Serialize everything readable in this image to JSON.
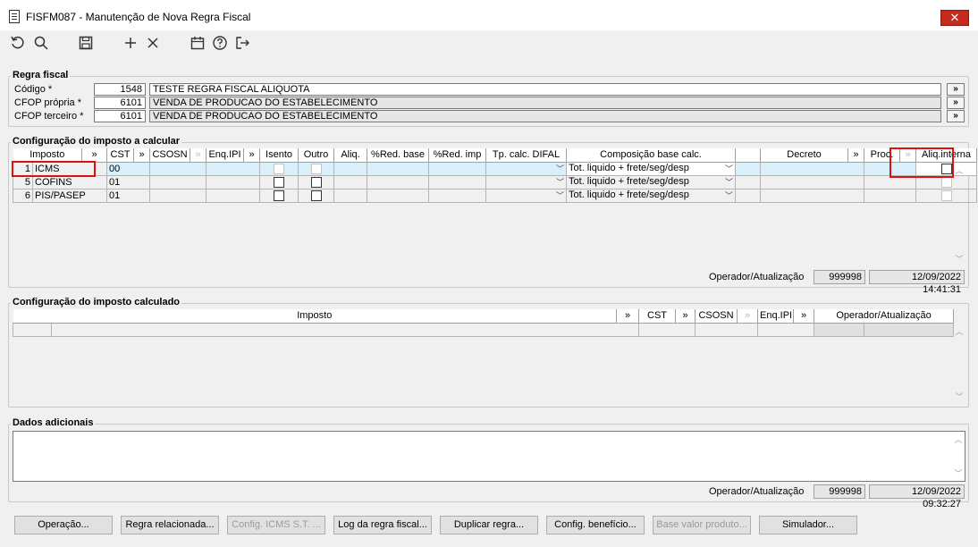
{
  "window": {
    "title": "FISFM087 - Manutenção de Nova Regra Fiscal",
    "close_glyph": "✕"
  },
  "toolbar": {
    "icons": [
      "undo-icon",
      "search-icon",
      "save-icon",
      "add-icon",
      "delete-icon",
      "calendar-icon",
      "help-icon",
      "exit-icon"
    ]
  },
  "regra_fiscal": {
    "legend": "Regra fiscal",
    "codigo_label": "Código *",
    "codigo_value": "1548",
    "codigo_desc": "TESTE REGRA FISCAL ALIQUOTA",
    "cfop_propria_label": "CFOP própria *",
    "cfop_propria_value": "6101",
    "cfop_propria_desc": "VENDA DE PRODUCAO DO ESTABELECIMENTO",
    "cfop_terceiro_label": "CFOP terceiro *",
    "cfop_terceiro_value": "6101",
    "cfop_terceiro_desc": "VENDA DE PRODUCAO DO ESTABELECIMENTO",
    "search_glyph": "»"
  },
  "config_calcular": {
    "legend": "Configuração do imposto a calcular",
    "headers": {
      "imposto": "Imposto",
      "more": "»",
      "cst": "CST",
      "csosn": "CSOSN",
      "enq_ipi": "Enq.IPI",
      "isento": "Isento",
      "outro": "Outro",
      "aliq": "Aliq.",
      "red_base": "%Red. base",
      "red_imp": "%Red. imp",
      "tp_calc": "Tp. calc. DIFAL",
      "composicao": "Composição base calc.",
      "decreto": "Decreto",
      "proc": "Proc.",
      "aliq_interna": "Aliq.interna"
    },
    "rows": [
      {
        "n": "1",
        "imposto": "ICMS",
        "cst": "00",
        "composicao": "Tot. liquido + frete/seg/desp"
      },
      {
        "n": "5",
        "imposto": "COFINS",
        "cst": "01",
        "composicao": "Tot. liquido + frete/seg/desp"
      },
      {
        "n": "6",
        "imposto": "PIS/PASEP",
        "cst": "01",
        "composicao": "Tot. liquido + frete/seg/desp"
      }
    ],
    "operador_label": "Operador/Atualização",
    "operador": "999998",
    "atualizacao": "12/09/2022 14:41:31"
  },
  "config_calculado": {
    "legend": "Configuração do imposto calculado",
    "headers": {
      "imposto": "Imposto",
      "more": "»",
      "cst": "CST",
      "csosn": "CSOSN",
      "enq_ipi": "Enq.IPI",
      "operador": "Operador/Atualização"
    }
  },
  "dados_adicionais": {
    "legend": "Dados adicionais",
    "operador_label": "Operador/Atualização",
    "operador": "999998",
    "atualizacao": "12/09/2022 09:32:27"
  },
  "buttons": {
    "operacao": "Operação...",
    "regra_relacionada": "Regra relacionada...",
    "config_icms_st": "Config. ICMS S.T. ...",
    "log_regra": "Log da regra fiscal...",
    "duplicar": "Duplicar regra...",
    "config_beneficio": "Config. benefício...",
    "base_valor": "Base valor produto...",
    "simulador": "Simulador..."
  },
  "colors": {
    "highlight_border": "#dd1111",
    "editable_cell": "#d9f0fa",
    "close_button": "#c42b1c"
  }
}
